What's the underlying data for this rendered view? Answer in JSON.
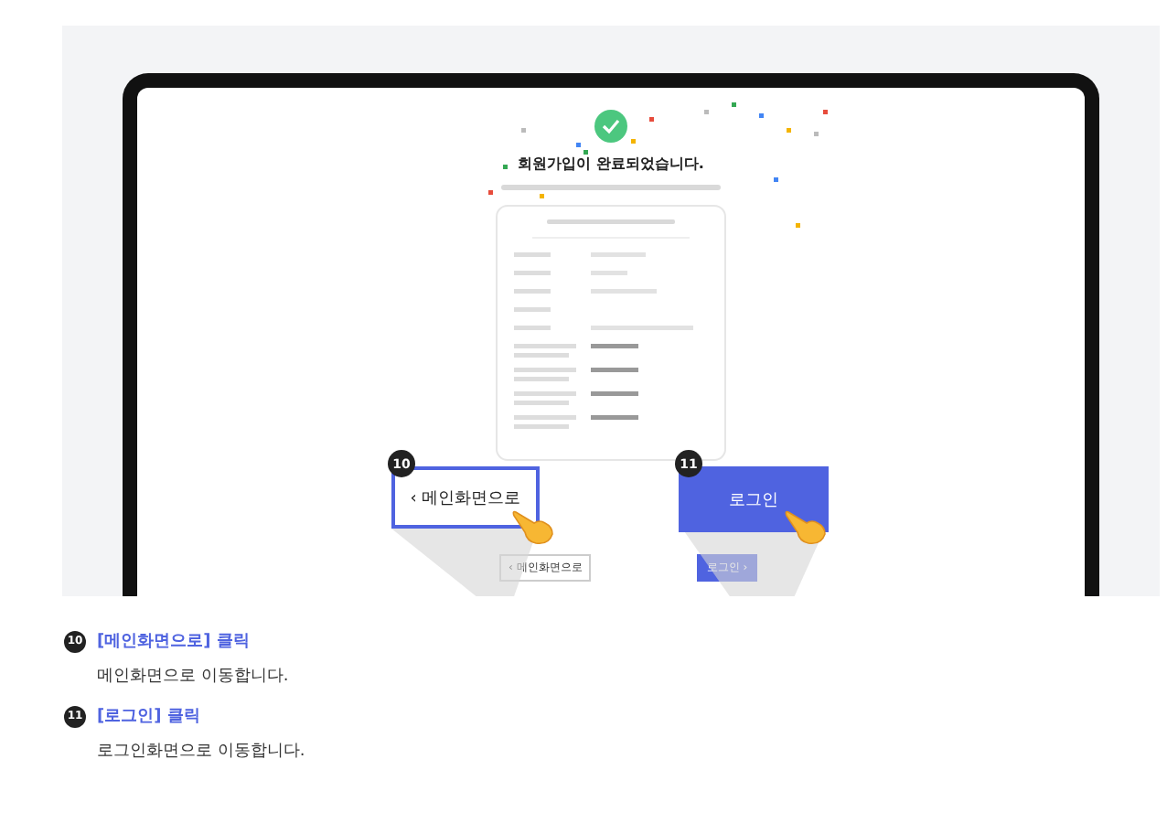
{
  "screen": {
    "title": "회원가입이 완료되었습니다.",
    "small_buttons": [
      {
        "kind": "outline",
        "label": "‹ 메인화면으로"
      },
      {
        "kind": "primary",
        "label": "로그인 ›"
      }
    ]
  },
  "callouts": [
    {
      "number": "10",
      "kind": "outline",
      "label": "‹ 메인화면으로"
    },
    {
      "number": "11",
      "kind": "primary",
      "label": "로그인"
    }
  ],
  "steps": [
    {
      "number": "10",
      "title": "[메인화면으로] 클릭",
      "description": "메인화면으로 이동합니다."
    },
    {
      "number": "11",
      "title": "[로그인] 클릭",
      "description": "로그인화면으로 이동합니다."
    }
  ]
}
